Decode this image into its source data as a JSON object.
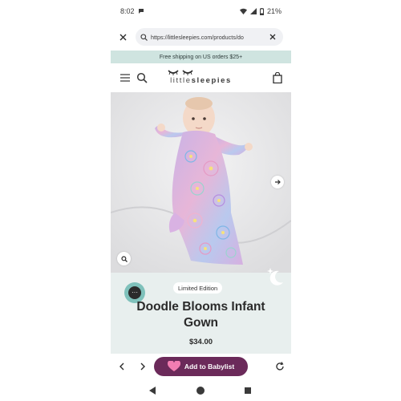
{
  "status_bar": {
    "time": "8:02",
    "battery": "21%"
  },
  "browser": {
    "url": "https://littlesleepies.com/products/do"
  },
  "promo": {
    "text": "Free shipping on US orders $25+"
  },
  "header": {
    "logo_light": "little",
    "logo_bold": "sleepies"
  },
  "product": {
    "badge": "Limited Edition",
    "title": "Doodle Blooms Infant Gown",
    "price": "$34.00"
  },
  "toolbar": {
    "babylist_label": "Add to Babylist"
  },
  "colors": {
    "promo_bg": "#cfe4e0",
    "info_bg": "#e8efee",
    "babylist": "#6b2a5a",
    "chat": "#7fc1bb"
  }
}
